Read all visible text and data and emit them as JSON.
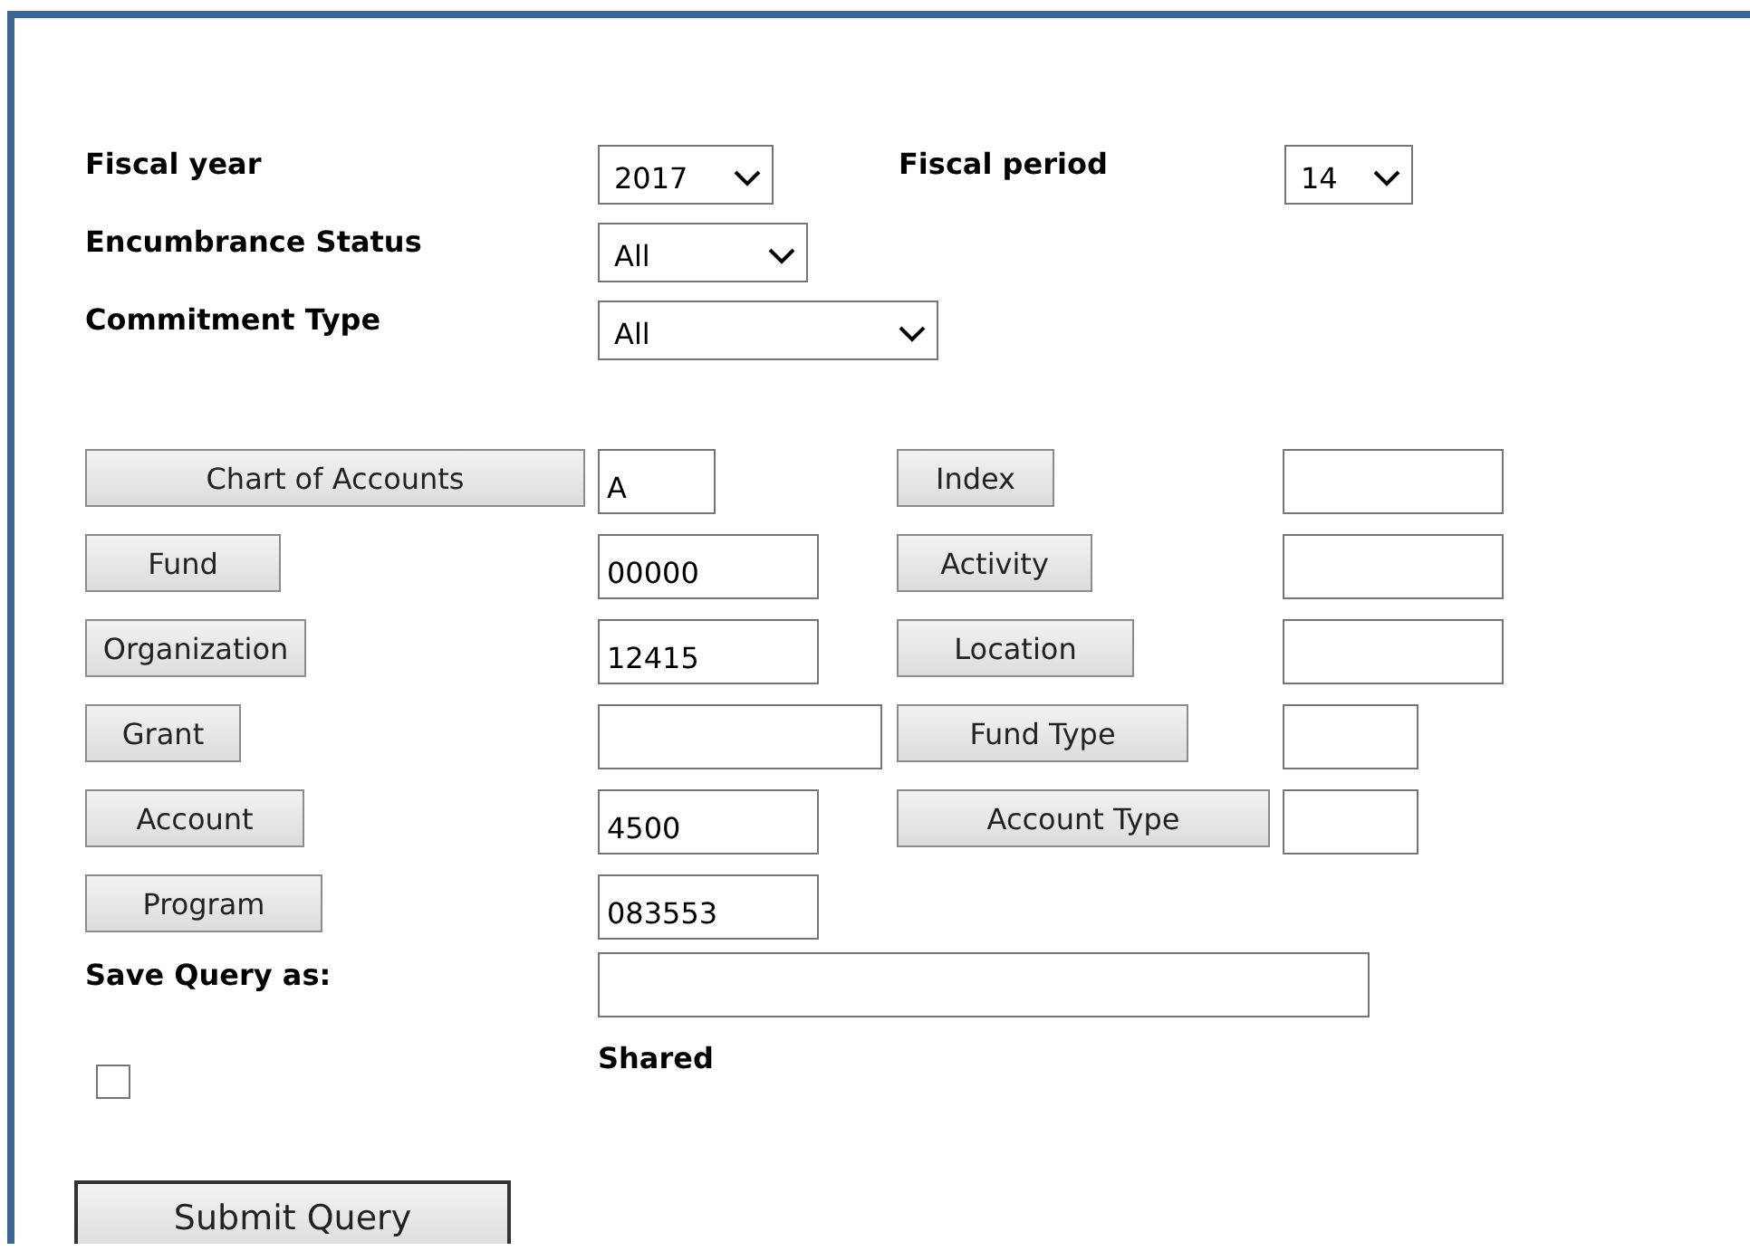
{
  "selects": [
    {
      "label": "Fiscal year",
      "value": "2017"
    },
    {
      "label": "Fiscal period",
      "value": "14"
    },
    {
      "label": "Encumbrance Status",
      "value": "All"
    },
    {
      "label": "Commitment Type",
      "value": "All"
    }
  ],
  "left_fields": [
    {
      "button": "Chart of Accounts",
      "value": "A"
    },
    {
      "button": "Fund",
      "value": "00000"
    },
    {
      "button": "Organization",
      "value": "12415"
    },
    {
      "button": "Grant"
    },
    {
      "button": "Account",
      "value": "4500"
    },
    {
      "button": "Program",
      "value": "083553"
    }
  ],
  "right_fields": [
    {
      "button": "Index"
    },
    {
      "button": "Activity"
    },
    {
      "button": "Location"
    },
    {
      "button": "Fund Type"
    },
    {
      "button": "Account Type"
    }
  ],
  "save_query": {
    "label": "Save Query as:"
  },
  "shared": {
    "label": "Shared",
    "checked": false
  },
  "submit": "Submit Query"
}
